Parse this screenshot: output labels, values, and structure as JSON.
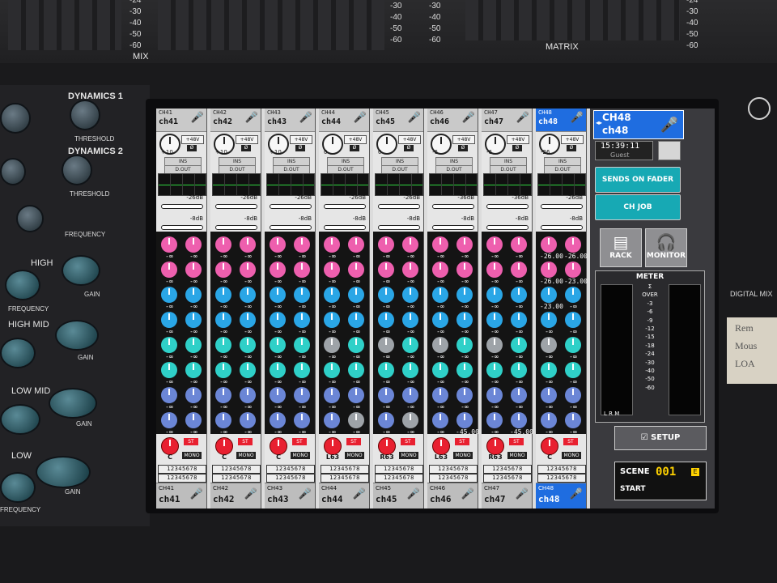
{
  "console": {
    "mix_label": "MIX",
    "matrix_label": "MATRIX",
    "scale_left": [
      "-24",
      "-30",
      "-40",
      "-50",
      "-60"
    ],
    "scale_mid": [
      "-30",
      "-40",
      "-50",
      "-60"
    ],
    "scale_mid2": [
      "-30",
      "-40",
      "-50",
      "-60"
    ],
    "scale_right": [
      "-24",
      "-30",
      "-40",
      "-50",
      "-60"
    ],
    "dyn1": "DYNAMICS 1",
    "dyn2": "DYNAMICS 2",
    "threshold1": "THRESHOLD",
    "threshold2": "THRESHOLD",
    "frequency": "FREQUENCY",
    "high": "HIGH",
    "gain1": "GAIN",
    "frequency2": "FREQUENCY",
    "high_mid": "HIGH MID",
    "gain2": "GAIN",
    "low_mid": "LOW MID",
    "gain3": "GAIN",
    "low": "LOW",
    "gain4": "GAIN",
    "frequency3": "FREQUENCY",
    "digital_mix": "DIGITAL MIX",
    "note_lines": [
      "Rem",
      "Mous",
      "LOA"
    ]
  },
  "strip_common": {
    "p48": "+48V",
    "phase": "Ø",
    "ins": "INS",
    "dout": "D.OUT",
    "mono": "MONO",
    "st": "ST",
    "bus": "12345678",
    "inf": "-∞"
  },
  "channels": [
    {
      "num": "CH41",
      "name": "ch41",
      "gain": "+10",
      "db1": "-26dB",
      "db2": "-8dB",
      "pan": "C"
    },
    {
      "num": "CH42",
      "name": "ch42",
      "gain": "+10",
      "db1": "-26dB",
      "db2": "-8dB",
      "pan": "C"
    },
    {
      "num": "CH43",
      "name": "ch43",
      "gain": "+10",
      "db1": "-26dB",
      "db2": "-8dB",
      "pan": "C"
    },
    {
      "num": "CH44",
      "name": "ch44",
      "gain": "0",
      "db1": "-26dB",
      "db2": "-8dB",
      "pan": "L63"
    },
    {
      "num": "CH45",
      "name": "ch45",
      "gain": "0",
      "db1": "-26dB",
      "db2": "-8dB",
      "pan": "R63"
    },
    {
      "num": "CH46",
      "name": "ch46",
      "gain": "-6",
      "db1": "-36dB",
      "db2": "-8dB",
      "pan": "L63"
    },
    {
      "num": "CH47",
      "name": "ch47",
      "gain": "-6",
      "db1": "-36dB",
      "db2": "-8dB",
      "pan": "R63"
    },
    {
      "num": "CH48",
      "name": "ch48",
      "gain": "-26",
      "db1": "-26dB",
      "db2": "-8dB",
      "pan": "C"
    }
  ],
  "special_values": {
    "ch48_r1l": "-26.00",
    "ch48_r1r": "-26.00",
    "ch48_r2l": "-26.00",
    "ch48_r2r": "-23.00",
    "ch48_r3l": "-23.00",
    "ch46_r8r": "-45.00",
    "ch47_r8r": "-45.00"
  },
  "right_panel": {
    "ch_num": "CH48",
    "ch_name": "ch48",
    "time": "15:39:11",
    "user": "Guest",
    "sends_on_fader": "SENDS ON FADER",
    "ch_job": "CH JOB",
    "rack": "RACK",
    "monitor": "MONITOR",
    "meter_title": "METER",
    "meter_scale": [
      "Σ",
      "OVER",
      "-3",
      "-6",
      "-9",
      "-12",
      "-15",
      "-18",
      "-24",
      "-30",
      "-40",
      "-50",
      "-60"
    ],
    "lrm": "L R M",
    "setup": "SETUP",
    "scene_label": "SCENE",
    "scene_num": "001",
    "scene_name": "START",
    "scene_badge": "E"
  },
  "colors": {
    "screen_bg": "#dcdcdc",
    "selected": "#1f6de0",
    "teal_button": "#17a9b4",
    "pan_red": "#e82030",
    "send_pink": "#ee5fae",
    "send_blue": "#2aa6e6",
    "send_cyan": "#2fd0c8",
    "send_grey": "#9ea3a8",
    "send_purple": "#6b86d6"
  },
  "icons": {
    "mic": "microphone-icon",
    "rack": "rack-icon",
    "monitor": "headphones-icon",
    "setup": "checkbox-icon",
    "nav": "arrow-left-right-icon"
  }
}
